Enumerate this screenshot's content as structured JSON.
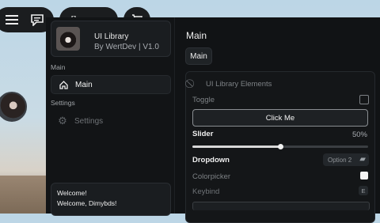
{
  "window": {
    "profile": {
      "title": "UI Library",
      "subtitle": "By WertDev | V1.0"
    },
    "sections": {
      "main": "Main",
      "settings": "Settings"
    },
    "nav": [
      {
        "label": "Main",
        "icon": "home-icon",
        "active": true
      },
      {
        "label": "Settings",
        "icon": "gear-icon",
        "active": false
      }
    ],
    "welcome": {
      "line1": "Welcome!",
      "line2": "Welcome, Dimybds!"
    }
  },
  "main": {
    "title": "Main",
    "tabs": [
      {
        "label": "Main"
      }
    ],
    "panel": {
      "title": "UI Library Elements",
      "toggle": {
        "label": "Toggle",
        "checked": false
      },
      "button": {
        "label": "Click Me"
      },
      "slider": {
        "label": "Slider",
        "value_text": "50%",
        "value": 0.5
      },
      "dropdown": {
        "label": "Dropdown",
        "selected": "Option 2"
      },
      "colorpicker": {
        "label": "Colorpicker",
        "color": "#f4f4f4"
      },
      "keybind": {
        "label": "Keybind",
        "key": "E"
      }
    }
  },
  "topbar": {
    "icons": [
      "menu-icon",
      "chat-icon",
      "backpack-icon",
      "cart-icon"
    ]
  }
}
